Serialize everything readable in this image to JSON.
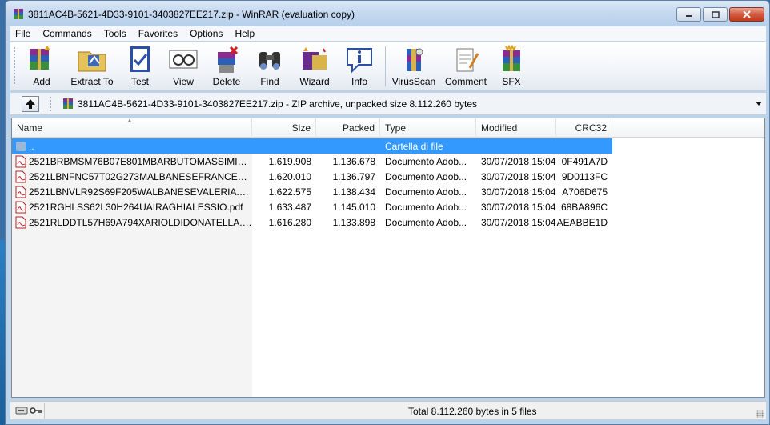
{
  "window": {
    "title": "3811AC4B-5621-4D33-9101-3403827EE217.zip - WinRAR (evaluation copy)"
  },
  "menu": [
    "File",
    "Commands",
    "Tools",
    "Favorites",
    "Options",
    "Help"
  ],
  "toolbar": [
    {
      "label": "Add",
      "icon": "add-icon"
    },
    {
      "label": "Extract To",
      "icon": "extract-icon"
    },
    {
      "label": "Test",
      "icon": "test-icon"
    },
    {
      "label": "View",
      "icon": "view-icon"
    },
    {
      "label": "Delete",
      "icon": "delete-icon"
    },
    {
      "label": "Find",
      "icon": "find-icon"
    },
    {
      "label": "Wizard",
      "icon": "wizard-icon"
    },
    {
      "label": "Info",
      "icon": "info-icon"
    },
    {
      "label": "VirusScan",
      "icon": "virusscan-icon"
    },
    {
      "label": "Comment",
      "icon": "comment-icon"
    },
    {
      "label": "SFX",
      "icon": "sfx-icon"
    }
  ],
  "address": {
    "text": "3811AC4B-5621-4D33-9101-3403827EE217.zip - ZIP archive, unpacked size 8.112.260 bytes"
  },
  "columns": {
    "name": "Name",
    "size": "Size",
    "packed": "Packed",
    "type": "Type",
    "modified": "Modified",
    "crc": "CRC32"
  },
  "parent_row": {
    "name": "..",
    "type": "Cartella di file"
  },
  "files": [
    {
      "name": "2521BRBMSM76B07E801MBARBUTOMASSIMILIAN...",
      "size": "1.619.908",
      "packed": "1.136.678",
      "type": "Documento Adob...",
      "modified": "30/07/2018 15:04",
      "crc": "0F491A7D"
    },
    {
      "name": "2521LBNFNC57T02G273MALBANESEFRANCESCO....",
      "size": "1.620.010",
      "packed": "1.136.797",
      "type": "Documento Adob...",
      "modified": "30/07/2018 15:04",
      "crc": "9D0113FC"
    },
    {
      "name": "2521LBNVLR92S69F205WALBANESEVALERIA.pdf",
      "size": "1.622.575",
      "packed": "1.138.434",
      "type": "Documento Adob...",
      "modified": "30/07/2018 15:04",
      "crc": "A706D675"
    },
    {
      "name": "2521RGHLSS62L30H264UAIRAGHIALESSIO.pdf",
      "size": "1.633.487",
      "packed": "1.145.010",
      "type": "Documento Adob...",
      "modified": "30/07/2018 15:04",
      "crc": "68BA896C"
    },
    {
      "name": "2521RLDDTL57H69A794XARIOLDIDONATELLA.pdf",
      "size": "1.616.280",
      "packed": "1.133.898",
      "type": "Documento Adob...",
      "modified": "30/07/2018 15:04",
      "crc": "AEABBE1D"
    }
  ],
  "status": {
    "text": "Total 8.112.260 bytes in 5 files"
  },
  "colors": {
    "selection": "#3399ff",
    "titlebar": "#c4d8ef",
    "close": "#c43a1c"
  }
}
